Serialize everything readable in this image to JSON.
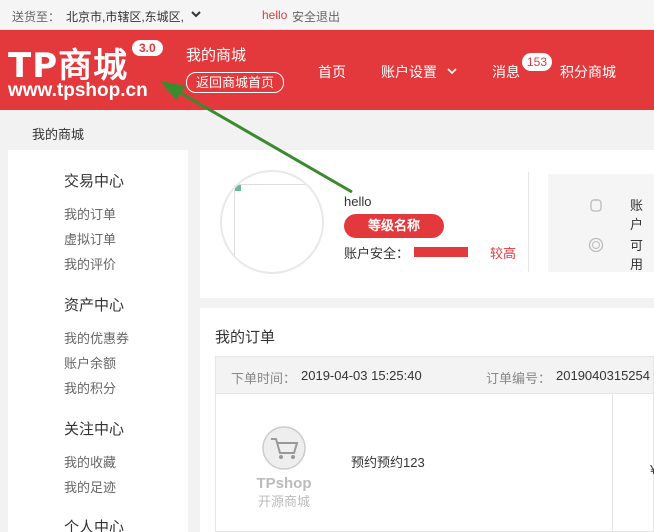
{
  "topbar": {
    "ship_label": "送货至：",
    "location": "北京市,市辖区,东城区,",
    "username": "hello",
    "logout": "安全退出"
  },
  "header": {
    "logo_name": "TP商城",
    "logo_url": "www.tpshop.cn",
    "version": "3.0",
    "my_mall": "我的商城",
    "back_home": "返回商城首页",
    "nav": {
      "home": "首页",
      "account": "账户设置",
      "messages": "消息",
      "message_count": "153",
      "points_mall": "积分商城"
    }
  },
  "breadcrumb": "我的商城",
  "sidebar": {
    "sections": [
      {
        "title": "交易中心",
        "items": [
          "我的订单",
          "虚拟订单",
          "我的评价"
        ]
      },
      {
        "title": "资产中心",
        "items": [
          "我的优惠券",
          "账户余额",
          "我的积分"
        ]
      },
      {
        "title": "关注中心",
        "items": [
          "我的收藏",
          "我的足迹"
        ]
      },
      {
        "title": "个人中心",
        "items": []
      }
    ]
  },
  "profile": {
    "username": "hello",
    "level_name": "等级名称",
    "security_label": "账户安全：",
    "security_level": "较高",
    "account_items": [
      "账户",
      "可用"
    ]
  },
  "orders": {
    "title": "我的订单",
    "time_label": "下单时间：",
    "time_value": "2019-04-03 15:25:40",
    "number_label": "订单编号：",
    "number_value": "2019040315254",
    "product_name": "预约预约123",
    "placeholder_brand": "TPshop",
    "placeholder_text": "开源商城",
    "price_fragment": "¥"
  },
  "colors": {
    "brand_red": "#e4393c",
    "annotation_green": "#3a8a2e"
  }
}
